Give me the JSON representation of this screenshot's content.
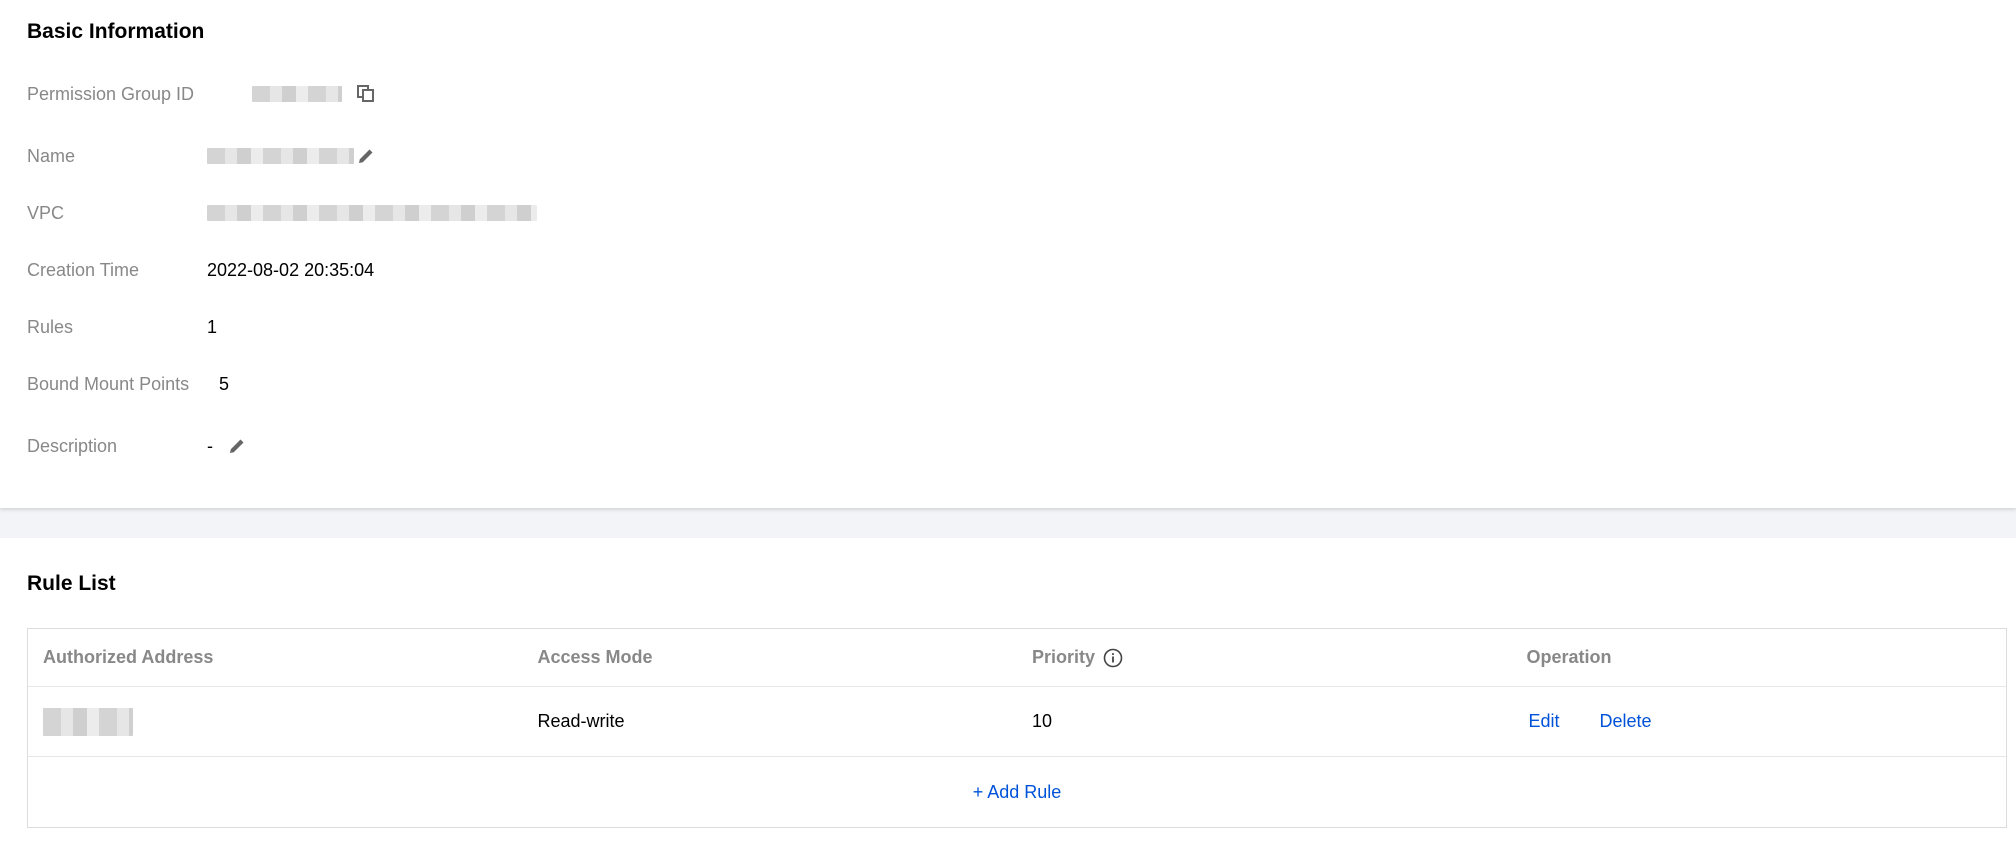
{
  "basic": {
    "title": "Basic Information",
    "fields": {
      "permission_group_id": {
        "label": "Permission Group ID"
      },
      "name": {
        "label": "Name"
      },
      "vpc": {
        "label": "VPC"
      },
      "creation_time": {
        "label": "Creation Time",
        "value": "2022-08-02 20:35:04"
      },
      "rules": {
        "label": "Rules",
        "value": "1"
      },
      "bound_mount_points": {
        "label": "Bound Mount Points",
        "value": "5"
      },
      "description": {
        "label": "Description",
        "value": "-"
      }
    }
  },
  "rule_list": {
    "title": "Rule List",
    "columns": [
      "Authorized Address",
      "Access Mode",
      "Priority",
      "Operation"
    ],
    "rows": [
      {
        "access_mode": "Read-write",
        "priority": "10",
        "edit_label": "Edit",
        "delete_label": "Delete"
      }
    ],
    "add_rule_label": "+ Add Rule"
  },
  "icons": {
    "copy": "copy-icon",
    "edit": "pencil-icon",
    "info": "info-icon"
  },
  "colors": {
    "link": "#0052d9",
    "label": "#888888",
    "background": "#f3f4f7"
  }
}
